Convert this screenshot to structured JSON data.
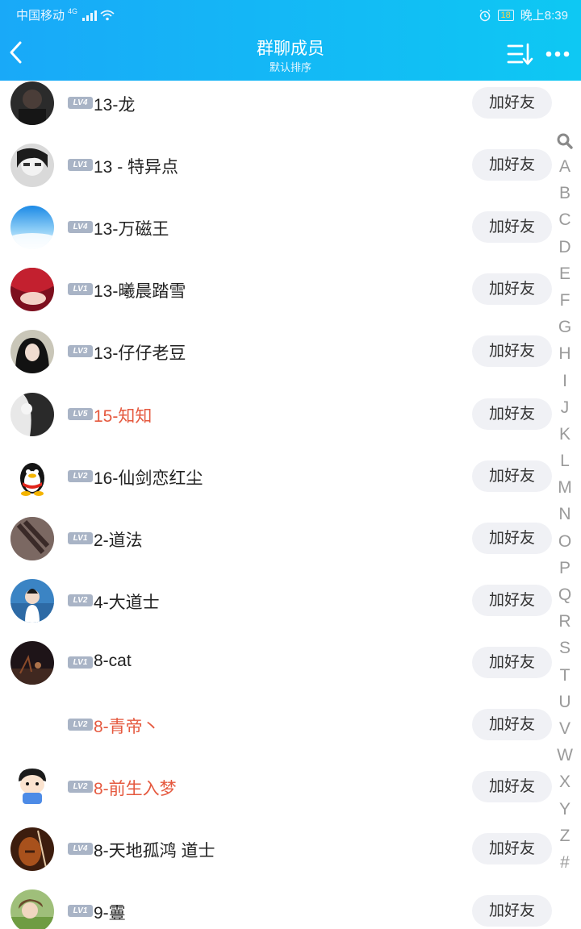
{
  "status_bar": {
    "carrier": "中国移动",
    "network": "4G",
    "battery": "18",
    "time": "晚上8:39"
  },
  "header": {
    "title": "群聊成员",
    "subtitle": "默认排序",
    "back_icon": "chevron-left-icon",
    "sort_icon": "sort-icon",
    "more_icon": "more-icon"
  },
  "colors": {
    "header_start": "#19a9f8",
    "header_end": "#0ec8f3",
    "highlight_name": "#e5593f",
    "badge": "#a9b4c6"
  },
  "members": [
    {
      "level": "LV4",
      "name": "13-龙",
      "highlight": false,
      "avatar": "dark"
    },
    {
      "level": "LV1",
      "name": "13 - 特异点",
      "highlight": false,
      "avatar": "mono"
    },
    {
      "level": "LV4",
      "name": "13-万磁王",
      "highlight": false,
      "avatar": "sky"
    },
    {
      "level": "LV1",
      "name": "13-曦晨踏雪",
      "highlight": false,
      "avatar": "red"
    },
    {
      "level": "LV3",
      "name": "13-仔仔老豆",
      "highlight": false,
      "avatar": "girl"
    },
    {
      "level": "LV5",
      "name": "15-知知",
      "highlight": true,
      "avatar": "bw"
    },
    {
      "level": "LV2",
      "name": "16-仙剑恋红尘",
      "highlight": false,
      "avatar": "penguin"
    },
    {
      "level": "LV1",
      "name": "2-道法",
      "highlight": false,
      "avatar": "brown"
    },
    {
      "level": "LV2",
      "name": "4-大道士",
      "highlight": false,
      "avatar": "sea"
    },
    {
      "level": "LV1",
      "name": "8-cat",
      "highlight": false,
      "avatar": "night"
    },
    {
      "level": "LV2",
      "name": "8-青帝丶",
      "highlight": true,
      "avatar": "none"
    },
    {
      "level": "LV2",
      "name": "8-前生入梦",
      "highlight": true,
      "avatar": "cartoon"
    },
    {
      "level": "LV4",
      "name": "8-天地孤鸿 道士",
      "highlight": false,
      "avatar": "violin"
    },
    {
      "level": "LV1",
      "name": "9-霻",
      "highlight": false,
      "avatar": "field"
    }
  ],
  "add_friend_label": "加好友",
  "index_letters": [
    "A",
    "B",
    "C",
    "D",
    "E",
    "F",
    "G",
    "H",
    "I",
    "J",
    "K",
    "L",
    "M",
    "N",
    "O",
    "P",
    "Q",
    "R",
    "S",
    "T",
    "U",
    "V",
    "W",
    "X",
    "Y",
    "Z",
    "#"
  ]
}
